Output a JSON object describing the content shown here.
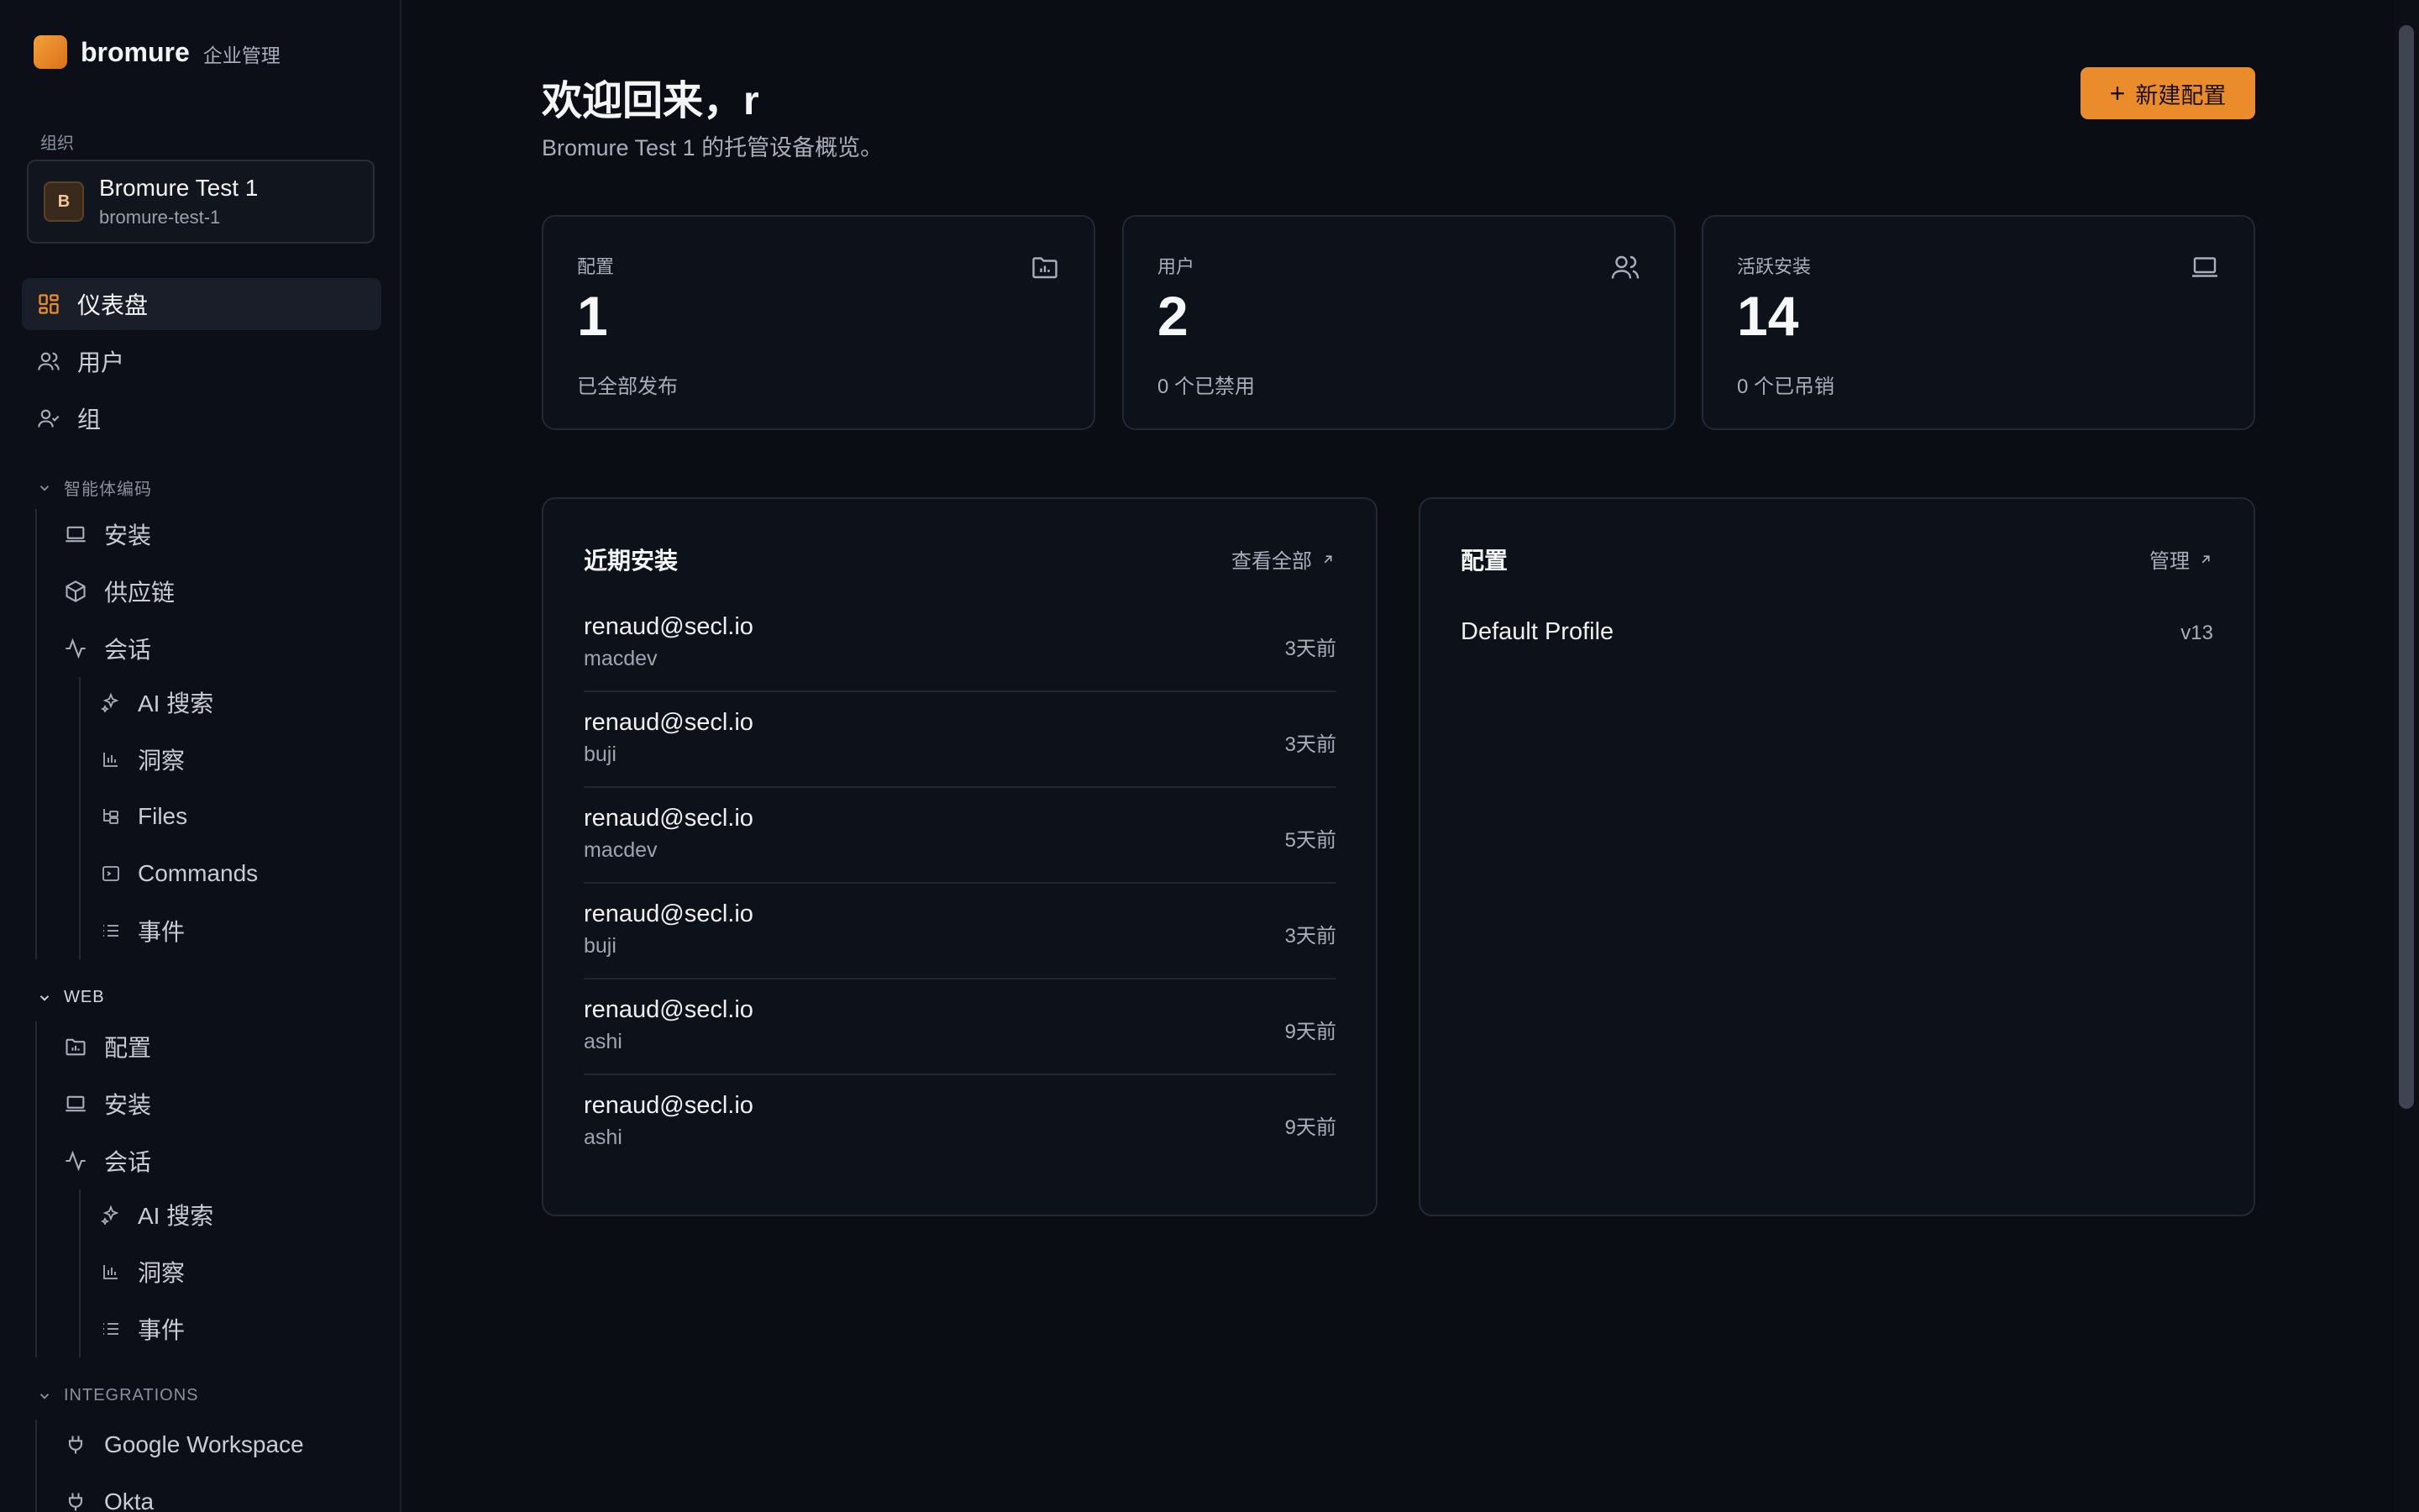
{
  "brand": {
    "name": "bromure",
    "subtitle": "企业管理"
  },
  "org": {
    "section_label": "组织",
    "avatar_letter": "B",
    "name": "Bromure Test 1",
    "slug": "bromure-test-1"
  },
  "nav": {
    "top": [
      {
        "label": "仪表盘",
        "icon": "dashboard-icon",
        "active": true
      },
      {
        "label": "用户",
        "icon": "users-icon"
      },
      {
        "label": "组",
        "icon": "group-icon"
      }
    ],
    "agent_section": {
      "title": "智能体编码",
      "items": [
        {
          "label": "安装",
          "icon": "laptop-icon"
        },
        {
          "label": "供应链",
          "icon": "package-icon"
        },
        {
          "label": "会话",
          "icon": "activity-icon"
        }
      ],
      "session_children": [
        {
          "label": "AI 搜索",
          "icon": "sparkles-icon"
        },
        {
          "label": "洞察",
          "icon": "bar-chart-icon"
        },
        {
          "label": "Files",
          "icon": "files-icon"
        },
        {
          "label": "Commands",
          "icon": "terminal-icon"
        },
        {
          "label": "事件",
          "icon": "list-icon"
        }
      ]
    },
    "web_section": {
      "title": "WEB",
      "items": [
        {
          "label": "配置",
          "icon": "folder-icon"
        },
        {
          "label": "安装",
          "icon": "laptop-icon"
        },
        {
          "label": "会话",
          "icon": "activity-icon"
        }
      ],
      "session_children": [
        {
          "label": "AI 搜索",
          "icon": "sparkles-icon"
        },
        {
          "label": "洞察",
          "icon": "bar-chart-icon"
        },
        {
          "label": "事件",
          "icon": "list-icon"
        }
      ]
    },
    "integrations_section": {
      "title": "INTEGRATIONS",
      "items": [
        {
          "label": "Google Workspace",
          "icon": "plug-icon"
        },
        {
          "label": "Okta",
          "icon": "plug-icon"
        }
      ]
    }
  },
  "header": {
    "greeting": "欢迎回来，r",
    "subtitle": "Bromure Test 1 的托管设备概览。",
    "new_button": "新建配置"
  },
  "stats": [
    {
      "label": "配置",
      "value": "1",
      "note": "已全部发布",
      "icon": "folder-chart-icon"
    },
    {
      "label": "用户",
      "value": "2",
      "note": "0 个已禁用",
      "icon": "users-icon"
    },
    {
      "label": "活跃安装",
      "value": "14",
      "note": "0 个已吊销",
      "icon": "laptop-icon"
    }
  ],
  "recent_installs": {
    "title": "近期安装",
    "link": "查看全部",
    "rows": [
      {
        "email": "renaud@secl.io",
        "host": "macdev",
        "time": "3天前"
      },
      {
        "email": "renaud@secl.io",
        "host": "buji",
        "time": "3天前"
      },
      {
        "email": "renaud@secl.io",
        "host": "macdev",
        "time": "5天前"
      },
      {
        "email": "renaud@secl.io",
        "host": "buji",
        "time": "3天前"
      },
      {
        "email": "renaud@secl.io",
        "host": "ashi",
        "time": "9天前"
      },
      {
        "email": "renaud@secl.io",
        "host": "ashi",
        "time": "9天前"
      }
    ]
  },
  "profiles_panel": {
    "title": "配置",
    "link": "管理",
    "rows": [
      {
        "name": "Default Profile",
        "version": "v13"
      }
    ]
  },
  "colors": {
    "accent": "#ea8c2c",
    "background": "#0a0d14",
    "card": "#0d1119",
    "border": "#232834"
  }
}
